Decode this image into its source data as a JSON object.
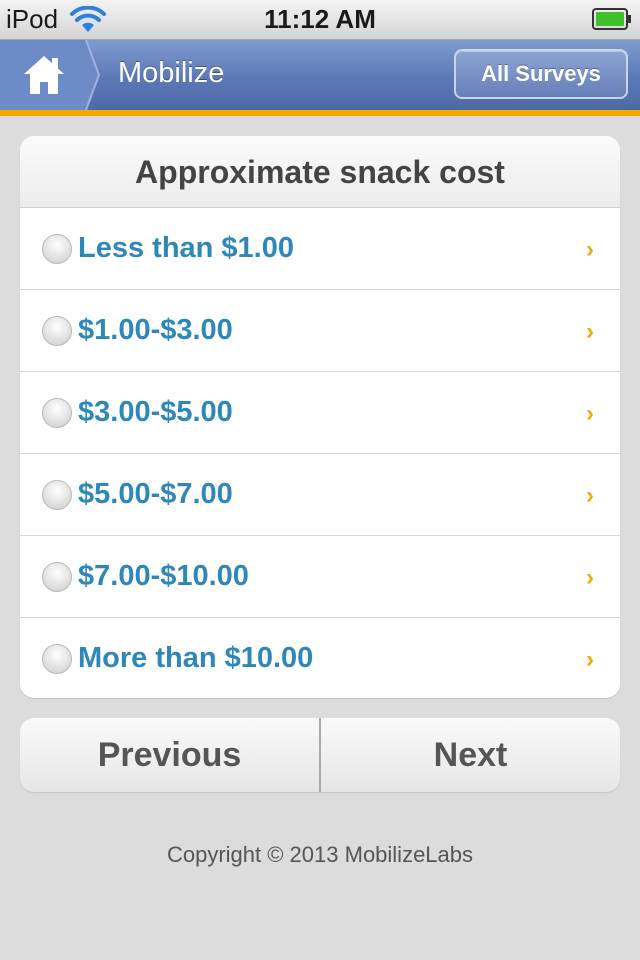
{
  "status_bar": {
    "carrier": "iPod",
    "time": "11:12 AM",
    "wifi_icon": "wifi-icon",
    "battery_icon": "battery-icon",
    "battery_color": "#3fbf2a"
  },
  "nav": {
    "home_icon": "home-icon",
    "title": "Mobilize",
    "all_surveys_label": "All Surveys",
    "accent_color": "#f2a900"
  },
  "question": {
    "title": "Approximate snack cost",
    "options": [
      {
        "label": "Less than $1.00"
      },
      {
        "label": "$1.00-$3.00"
      },
      {
        "label": "$3.00-$5.00"
      },
      {
        "label": "$5.00-$7.00"
      },
      {
        "label": "$7.00-$10.00"
      },
      {
        "label": "More than $10.00"
      }
    ],
    "option_color": "#2d87b8",
    "chevron_glyph": "›"
  },
  "pager": {
    "previous_label": "Previous",
    "next_label": "Next"
  },
  "footer": {
    "copyright": "Copyright © 2013 MobilizeLabs"
  }
}
